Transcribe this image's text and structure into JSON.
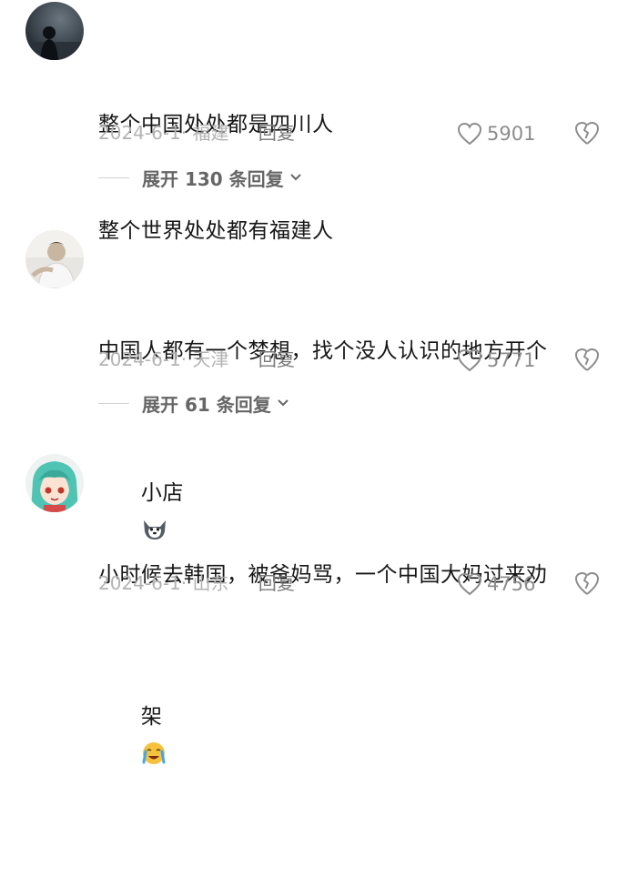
{
  "comments": [
    {
      "text_lines": [
        "整个中国处处都是四川人",
        "整个世界处处都有福建人"
      ],
      "date_loc": "2024-6-1· 福建",
      "reply_label": "回复",
      "likes": "5901",
      "expand_label": "展开 130 条回复",
      "avatar_icon": "dark-silhouette-avatar"
    },
    {
      "text_lines": [
        "中国人都有一个梦想，找个没人认识的地方开个",
        "小店"
      ],
      "emoji_icon": "husky-dog-emoji",
      "date_loc": "2024-6-1· 天津",
      "reply_label": "回复",
      "likes": "5771",
      "expand_label": "展开 61 条回复",
      "avatar_icon": "person-photo-avatar"
    },
    {
      "text_lines": [
        "小时候去韩国，被爸妈骂，一个中国大妈过来劝",
        "架"
      ],
      "emoji_icon": "crying-face-emoji",
      "date_loc": "2024-6-1· 山东",
      "reply_label": "回复",
      "likes": "4756",
      "avatar_icon": "anime-girl-avatar"
    }
  ],
  "colors": {
    "text": "#161616",
    "meta": "#b3b3b3",
    "reply": "#7a7a7a",
    "icon": "#8c8c8c"
  }
}
